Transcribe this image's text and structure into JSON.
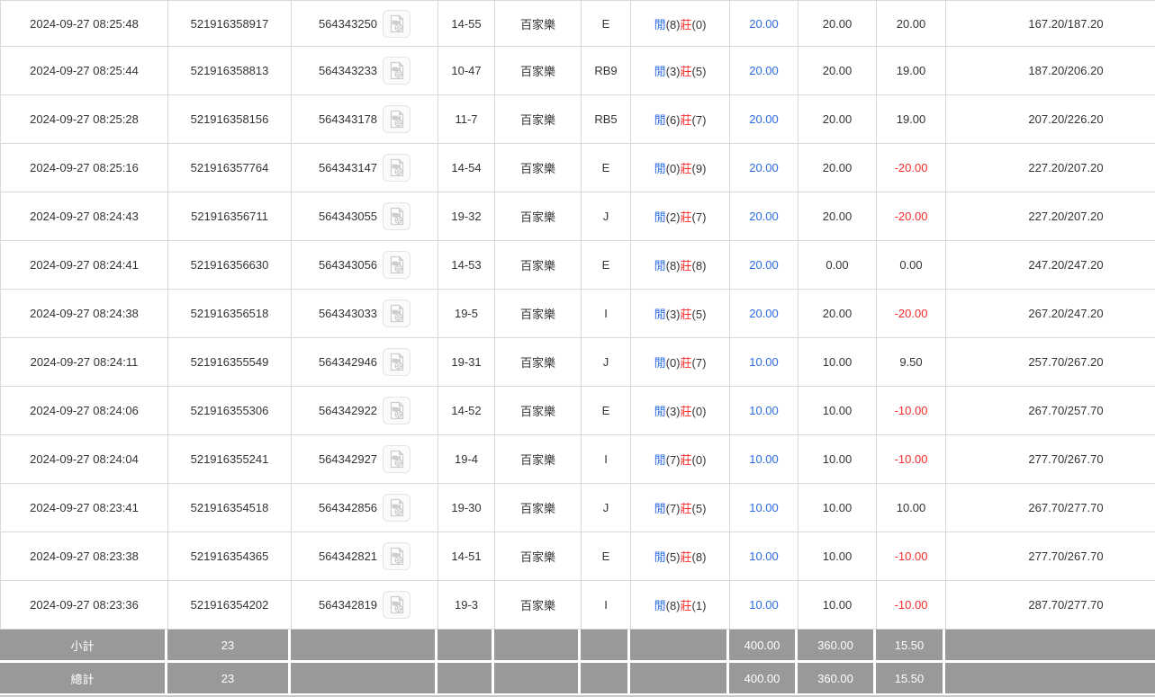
{
  "labels": {
    "result_player": "閒",
    "result_banker": "莊"
  },
  "icons": {
    "video_icon": "video-file-icon"
  },
  "colors": {
    "link_blue": "#2c6ce4",
    "loss_red": "#f92b2b",
    "row_border": "#d9d9d9",
    "footer_bg": "#999999",
    "text": "#333333"
  },
  "table": {
    "rows": [
      {
        "time": "2024-09-27 08:25:48",
        "bet_id": "521916358917",
        "round_id": "564343250",
        "table_no": "14-55",
        "game": "百家樂",
        "code": "E",
        "player_pts": "(8)",
        "banker_pts": "(0)",
        "bet": "20.00",
        "valid": "20.00",
        "win_loss": "20.00",
        "balance": "167.20/187.20"
      },
      {
        "time": "2024-09-27 08:25:44",
        "bet_id": "521916358813",
        "round_id": "564343233",
        "table_no": "10-47",
        "game": "百家樂",
        "code": "RB9",
        "player_pts": "(3)",
        "banker_pts": "(5)",
        "bet": "20.00",
        "valid": "20.00",
        "win_loss": "19.00",
        "balance": "187.20/206.20"
      },
      {
        "time": "2024-09-27 08:25:28",
        "bet_id": "521916358156",
        "round_id": "564343178",
        "table_no": "11-7",
        "game": "百家樂",
        "code": "RB5",
        "player_pts": "(6)",
        "banker_pts": "(7)",
        "bet": "20.00",
        "valid": "20.00",
        "win_loss": "19.00",
        "balance": "207.20/226.20"
      },
      {
        "time": "2024-09-27 08:25:16",
        "bet_id": "521916357764",
        "round_id": "564343147",
        "table_no": "14-54",
        "game": "百家樂",
        "code": "E",
        "player_pts": "(0)",
        "banker_pts": "(9)",
        "bet": "20.00",
        "valid": "20.00",
        "win_loss": "-20.00",
        "balance": "227.20/207.20"
      },
      {
        "time": "2024-09-27 08:24:43",
        "bet_id": "521916356711",
        "round_id": "564343055",
        "table_no": "19-32",
        "game": "百家樂",
        "code": "J",
        "player_pts": "(2)",
        "banker_pts": "(7)",
        "bet": "20.00",
        "valid": "20.00",
        "win_loss": "-20.00",
        "balance": "227.20/207.20"
      },
      {
        "time": "2024-09-27 08:24:41",
        "bet_id": "521916356630",
        "round_id": "564343056",
        "table_no": "14-53",
        "game": "百家樂",
        "code": "E",
        "player_pts": "(8)",
        "banker_pts": "(8)",
        "bet": "20.00",
        "valid": "0.00",
        "win_loss": "0.00",
        "balance": "247.20/247.20"
      },
      {
        "time": "2024-09-27 08:24:38",
        "bet_id": "521916356518",
        "round_id": "564343033",
        "table_no": "19-5",
        "game": "百家樂",
        "code": "I",
        "player_pts": "(3)",
        "banker_pts": "(5)",
        "bet": "20.00",
        "valid": "20.00",
        "win_loss": "-20.00",
        "balance": "267.20/247.20"
      },
      {
        "time": "2024-09-27 08:24:11",
        "bet_id": "521916355549",
        "round_id": "564342946",
        "table_no": "19-31",
        "game": "百家樂",
        "code": "J",
        "player_pts": "(0)",
        "banker_pts": "(7)",
        "bet": "10.00",
        "valid": "10.00",
        "win_loss": "9.50",
        "balance": "257.70/267.20"
      },
      {
        "time": "2024-09-27 08:24:06",
        "bet_id": "521916355306",
        "round_id": "564342922",
        "table_no": "14-52",
        "game": "百家樂",
        "code": "E",
        "player_pts": "(3)",
        "banker_pts": "(0)",
        "bet": "10.00",
        "valid": "10.00",
        "win_loss": "-10.00",
        "balance": "267.70/257.70"
      },
      {
        "time": "2024-09-27 08:24:04",
        "bet_id": "521916355241",
        "round_id": "564342927",
        "table_no": "19-4",
        "game": "百家樂",
        "code": "I",
        "player_pts": "(7)",
        "banker_pts": "(0)",
        "bet": "10.00",
        "valid": "10.00",
        "win_loss": "-10.00",
        "balance": "277.70/267.70"
      },
      {
        "time": "2024-09-27 08:23:41",
        "bet_id": "521916354518",
        "round_id": "564342856",
        "table_no": "19-30",
        "game": "百家樂",
        "code": "J",
        "player_pts": "(7)",
        "banker_pts": "(5)",
        "bet": "10.00",
        "valid": "10.00",
        "win_loss": "10.00",
        "balance": "267.70/277.70"
      },
      {
        "time": "2024-09-27 08:23:38",
        "bet_id": "521916354365",
        "round_id": "564342821",
        "table_no": "14-51",
        "game": "百家樂",
        "code": "E",
        "player_pts": "(5)",
        "banker_pts": "(8)",
        "bet": "10.00",
        "valid": "10.00",
        "win_loss": "-10.00",
        "balance": "277.70/267.70"
      },
      {
        "time": "2024-09-27 08:23:36",
        "bet_id": "521916354202",
        "round_id": "564342819",
        "table_no": "19-3",
        "game": "百家樂",
        "code": "I",
        "player_pts": "(8)",
        "banker_pts": "(1)",
        "bet": "10.00",
        "valid": "10.00",
        "win_loss": "-10.00",
        "balance": "287.70/277.70"
      }
    ]
  },
  "footer": {
    "subtotal": {
      "label": "小計",
      "count": "23",
      "bet": "400.00",
      "valid": "360.00",
      "win_loss": "15.50"
    },
    "total": {
      "label": "總計",
      "count": "23",
      "bet": "400.00",
      "valid": "360.00",
      "win_loss": "15.50"
    }
  }
}
